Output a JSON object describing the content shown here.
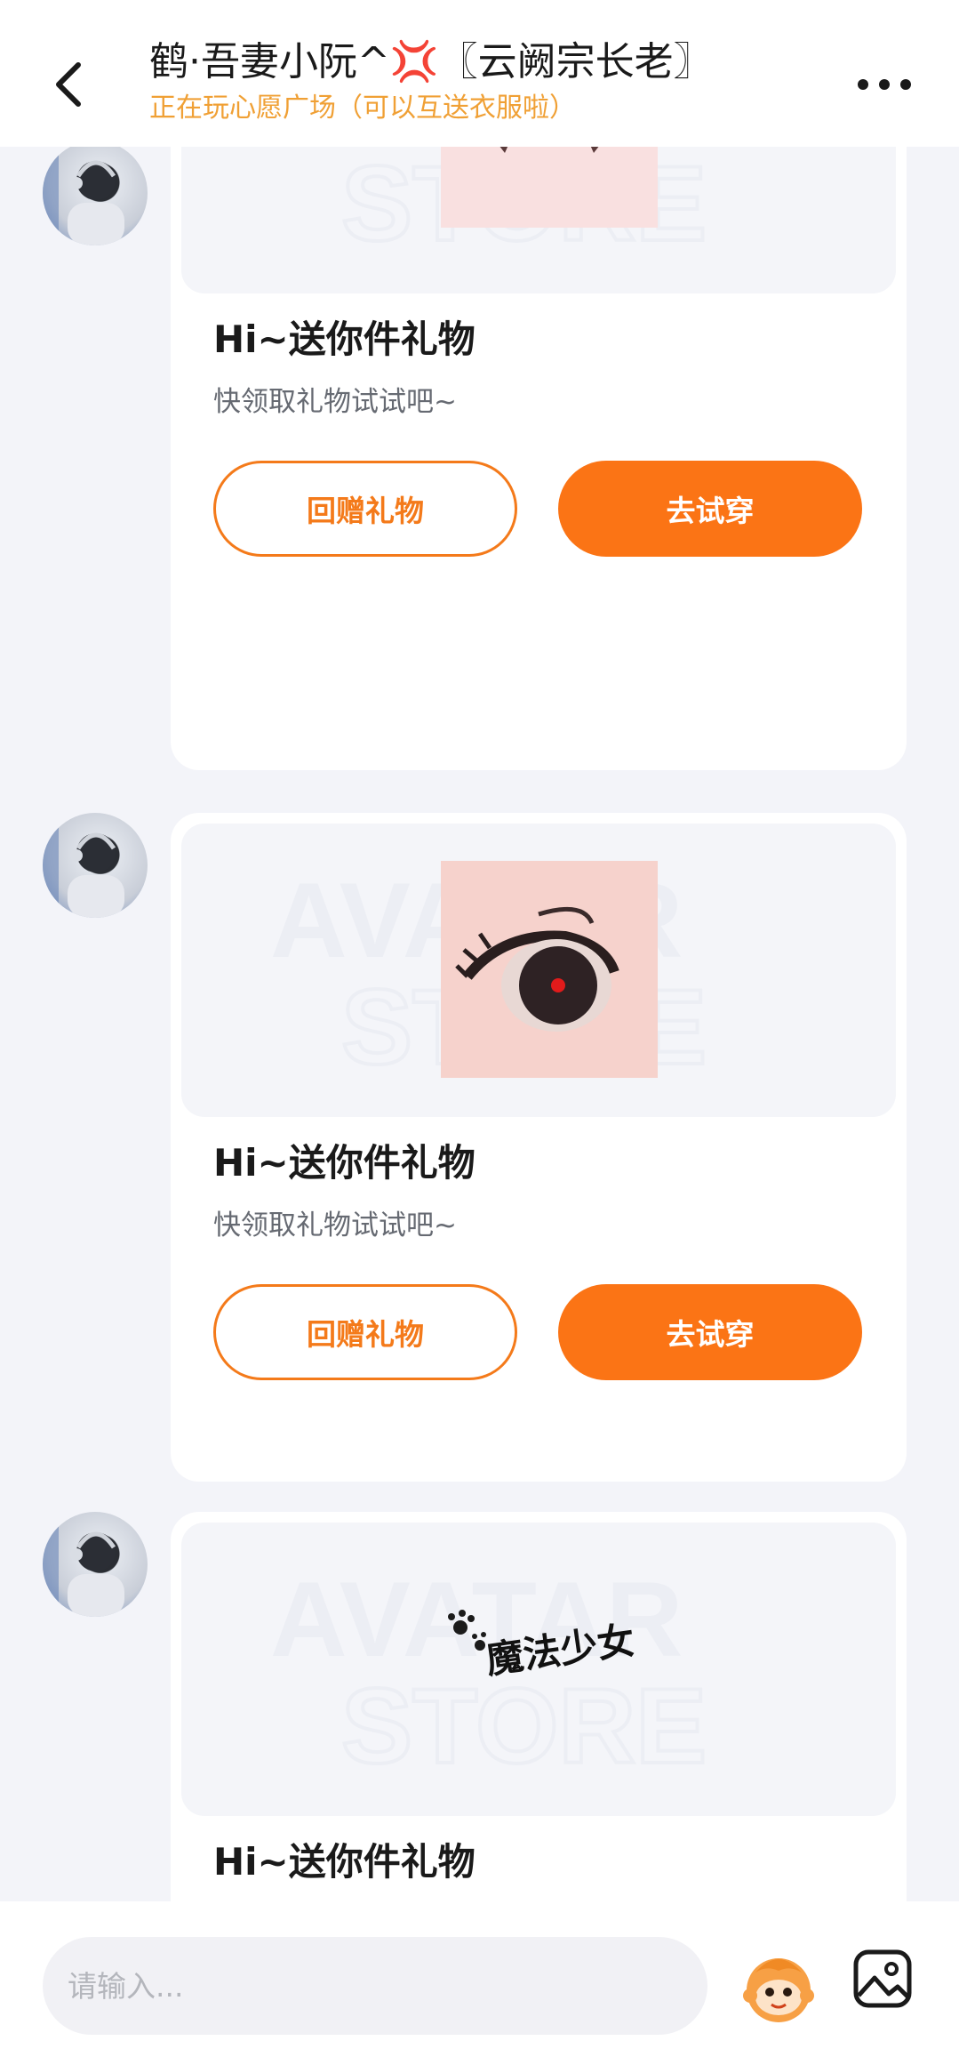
{
  "header": {
    "title": "鹤·吾妻小阮^💢〖云阙宗长老〗",
    "subtitle": "正在玩心愿广场（可以互送衣服啦）"
  },
  "messages": [
    {
      "card_title": "Hi~送你件礼物",
      "card_desc": "快领取礼物试试吧~",
      "return_label": "回赠礼物",
      "try_label": "去试穿",
      "item_icon": "fang-mouth-icon"
    },
    {
      "card_title": "Hi~送你件礼物",
      "card_desc": "快领取礼物试试吧~",
      "return_label": "回赠礼物",
      "try_label": "去试穿",
      "item_icon": "red-eye-icon"
    },
    {
      "card_title": "Hi~送你件礼物",
      "item_text": "魔法少女",
      "item_icon": "magic-girl-sticker-icon"
    }
  ],
  "composer": {
    "placeholder": "请输入..."
  },
  "colors": {
    "accent": "#fb7415",
    "subtitle": "#f0a035",
    "background": "#f3f4f9"
  }
}
